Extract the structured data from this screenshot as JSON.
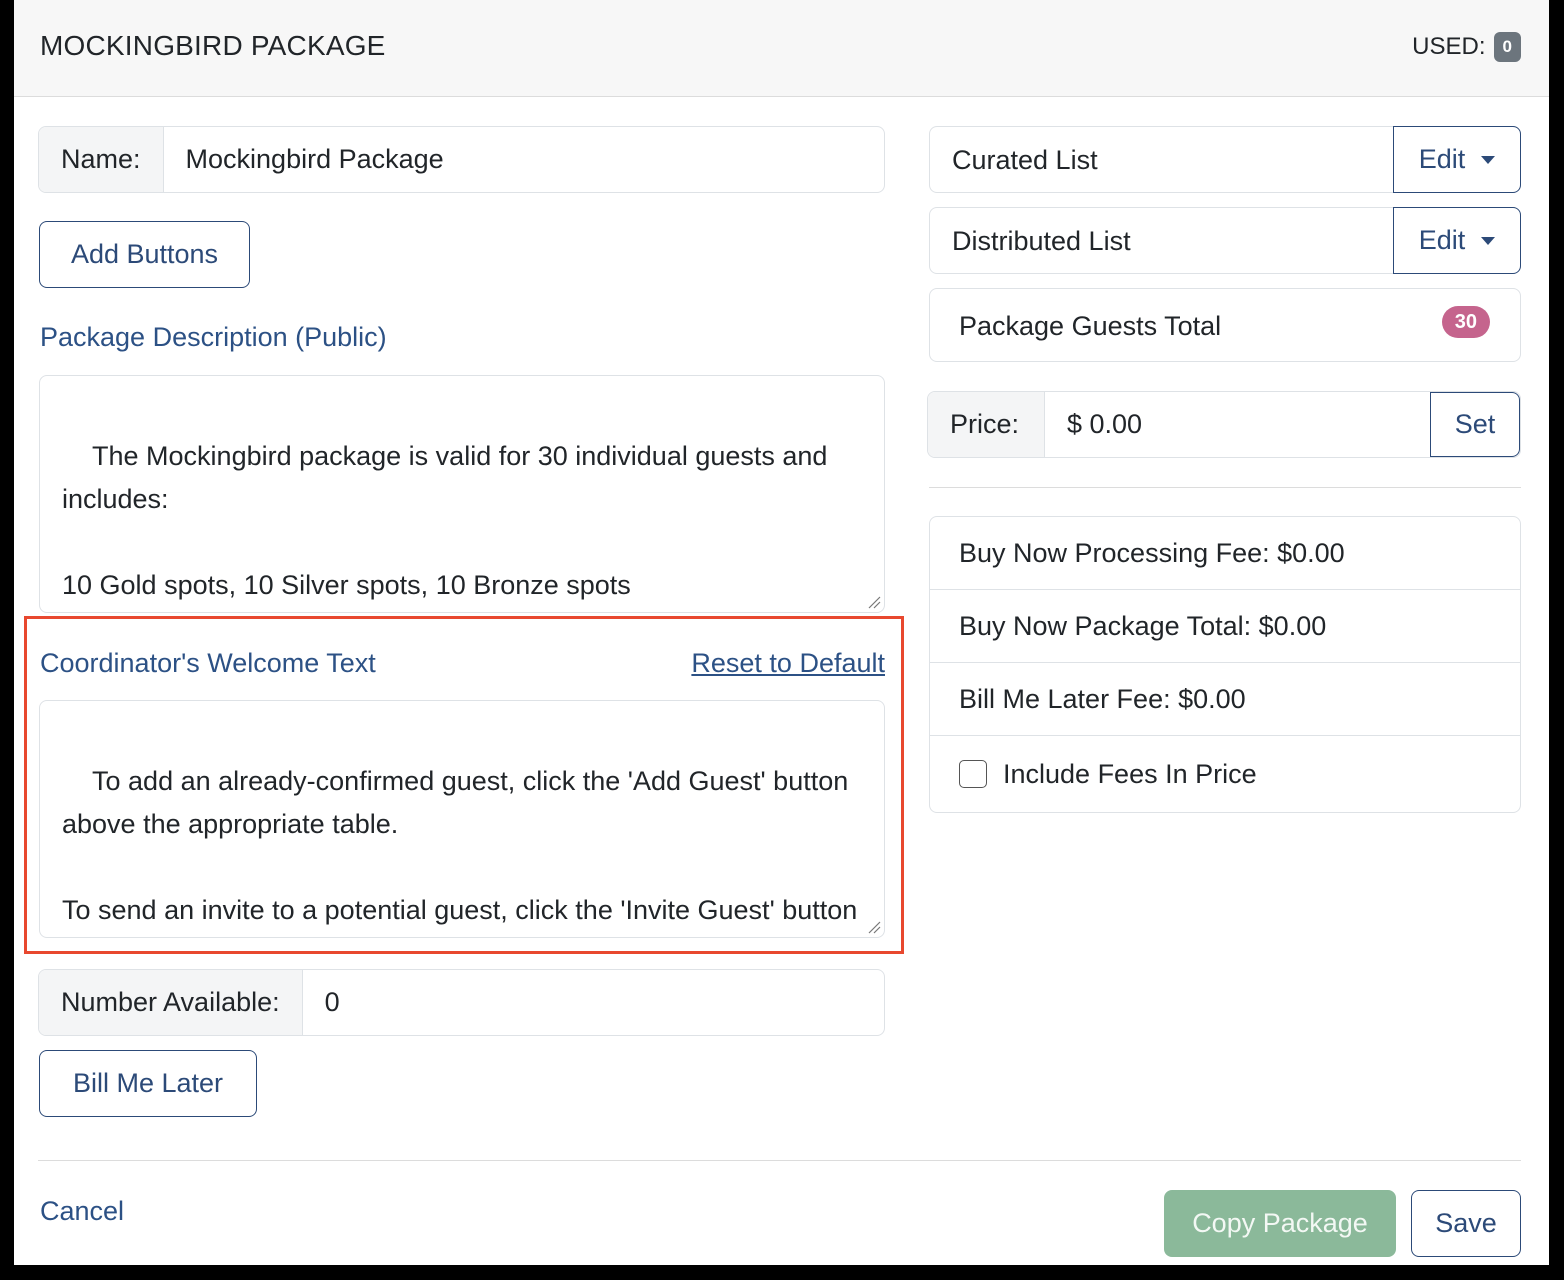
{
  "header": {
    "title": "MOCKINGBIRD PACKAGE",
    "used_label": "USED:",
    "used_count": "0"
  },
  "name_field": {
    "label": "Name:",
    "value": "Mockingbird Package"
  },
  "add_buttons_label": "Add Buttons",
  "description": {
    "label": "Package Description (Public)",
    "text": "The Mockingbird package is valid for 30 individual guests and includes:\n\n10 Gold spots, 10 Silver spots, 10 Bronze spots"
  },
  "welcome": {
    "label": "Coordinator's Welcome Text",
    "reset_label": "Reset to Default",
    "text": "To add an already-confirmed guest, click the 'Add Guest' button above the appropriate table.\n\nTo send an invite to a potential guest, click the 'Invite Guest' button above the appropriate table. The guest will receive an"
  },
  "number_available": {
    "label": "Number Available:",
    "value": "0"
  },
  "bill_me_later_label": "Bill Me Later",
  "right": {
    "curated_list": {
      "label": "Curated List",
      "edit_label": "Edit"
    },
    "distributed_list": {
      "label": "Distributed List",
      "edit_label": "Edit"
    },
    "guests_total": {
      "label": "Package Guests Total",
      "count": "30"
    },
    "price": {
      "label": "Price:",
      "value": "$ 0.00",
      "set_label": "Set"
    },
    "fees": {
      "processing_fee": "Buy Now Processing Fee: $0.00",
      "package_total": "Buy Now Package Total: $0.00",
      "bill_later_fee": "Bill Me Later Fee: $0.00",
      "include_fees_label": "Include Fees In Price"
    }
  },
  "footer": {
    "cancel_label": "Cancel",
    "copy_label": "Copy Package",
    "save_label": "Save"
  },
  "colors": {
    "link": "#2c5185",
    "highlight": "#e8482f",
    "badge_pink": "#c5648d",
    "copy_button": "#8bb99a"
  }
}
